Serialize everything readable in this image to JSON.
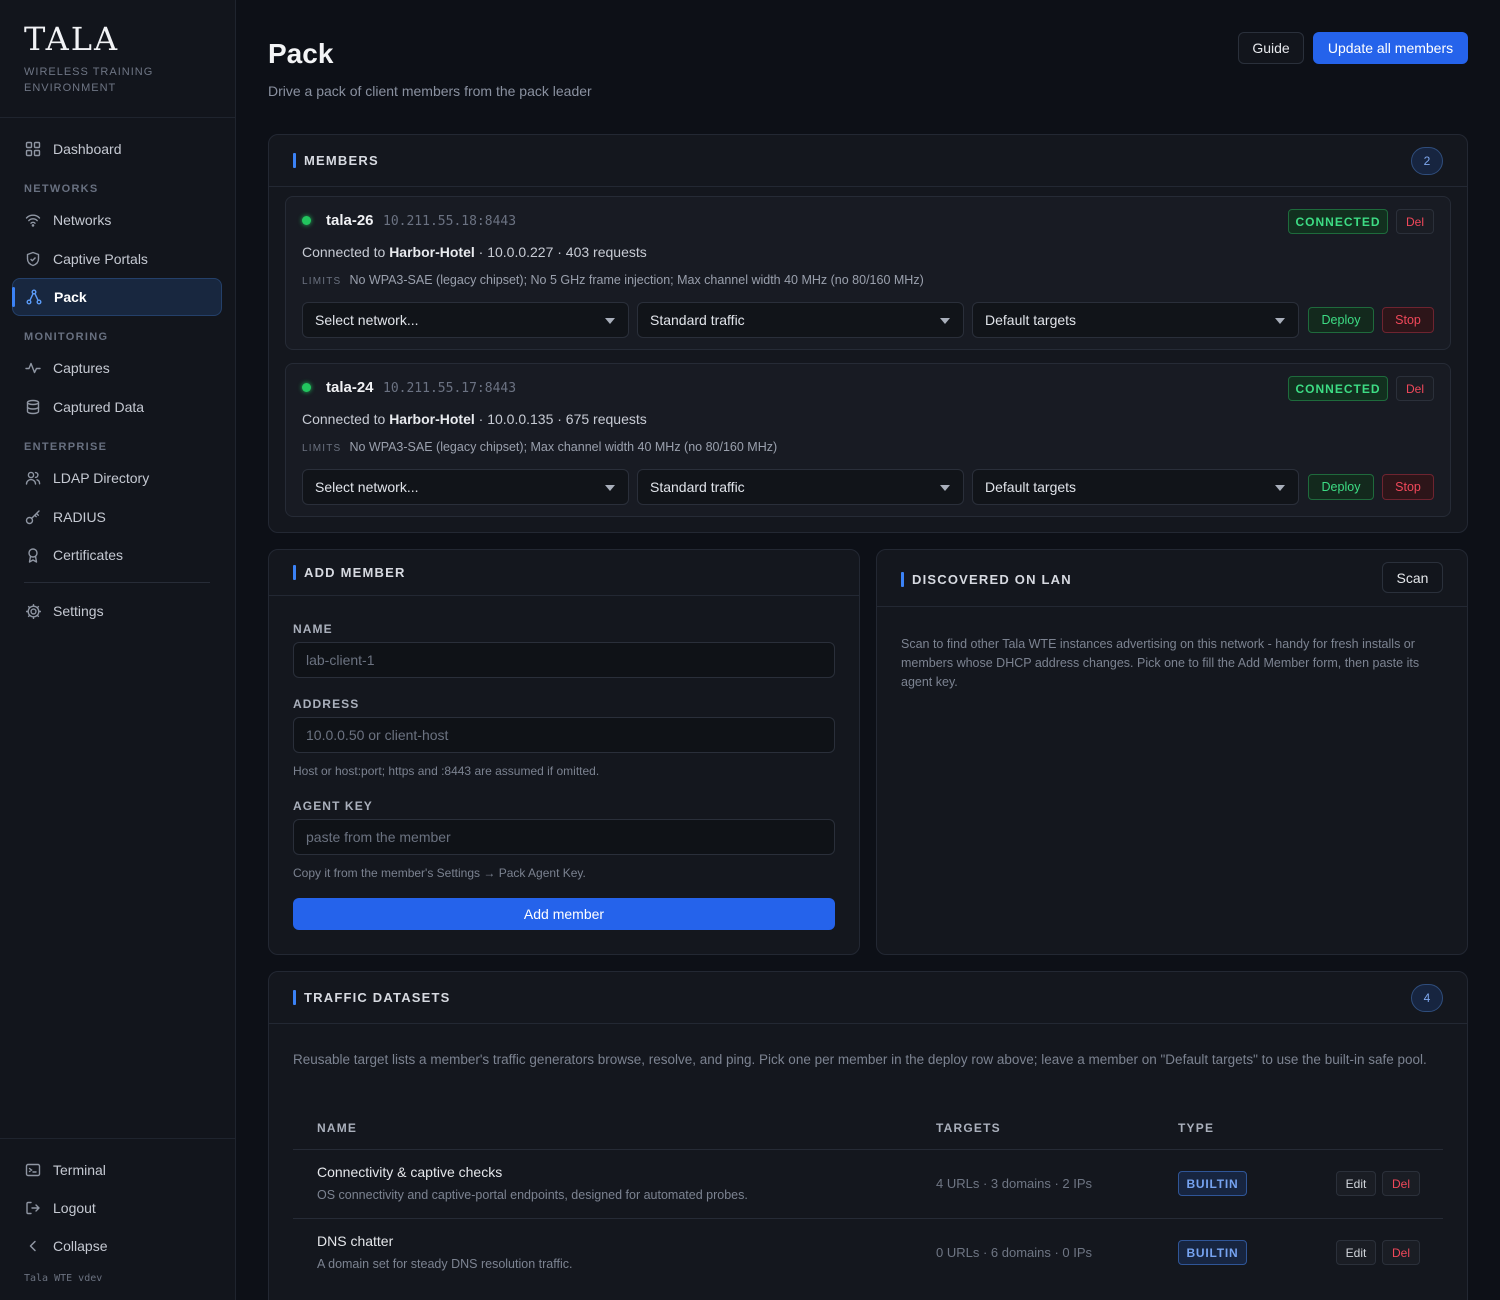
{
  "brand": {
    "logo": "TALA",
    "subtitle": "WIRELESS TRAINING ENVIRONMENT"
  },
  "nav": {
    "dashboard": "Dashboard",
    "section_networks": "NETWORKS",
    "networks": "Networks",
    "captive_portals": "Captive Portals",
    "pack": "Pack",
    "section_monitoring": "MONITORING",
    "captures": "Captures",
    "captured_data": "Captured Data",
    "section_enterprise": "ENTERPRISE",
    "ldap": "LDAP Directory",
    "radius": "RADIUS",
    "certificates": "Certificates",
    "settings": "Settings",
    "terminal": "Terminal",
    "logout": "Logout",
    "collapse": "Collapse",
    "version": "Tala WTE vdev"
  },
  "header": {
    "title": "Pack",
    "subtitle": "Drive a pack of client members from the pack leader",
    "guide": "Guide",
    "update_all": "Update all members"
  },
  "members": {
    "title": "MEMBERS",
    "count": "2",
    "items": [
      {
        "name": "tala-26",
        "address": "10.211.55.18:8443",
        "connected_prefix": "Connected to",
        "network": "Harbor-Hotel",
        "detail": "· 10.0.0.227 · 403 requests",
        "limits_label": "LIMITS",
        "limits": "No WPA3-SAE (legacy chipset); No 5 GHz frame injection; Max channel width 40 MHz (no 80/160 MHz)",
        "status": "CONNECTED",
        "del": "Del",
        "network_select": "Select network...",
        "traffic_select": "Standard traffic",
        "targets_select": "Default targets",
        "deploy": "Deploy",
        "stop": "Stop"
      },
      {
        "name": "tala-24",
        "address": "10.211.55.17:8443",
        "connected_prefix": "Connected to",
        "network": "Harbor-Hotel",
        "detail": "· 10.0.0.135 · 675 requests",
        "limits_label": "LIMITS",
        "limits": "No WPA3-SAE (legacy chipset); Max channel width 40 MHz (no 80/160 MHz)",
        "status": "CONNECTED",
        "del": "Del",
        "network_select": "Select network...",
        "traffic_select": "Standard traffic",
        "targets_select": "Default targets",
        "deploy": "Deploy",
        "stop": "Stop"
      }
    ]
  },
  "add_member": {
    "title": "ADD MEMBER",
    "name_label": "NAME",
    "name_placeholder": "lab-client-1",
    "address_label": "ADDRESS",
    "address_placeholder": "10.0.0.50 or client-host",
    "address_hint": "Host or host:port; https and :8443 are assumed if omitted.",
    "key_label": "AGENT KEY",
    "key_placeholder": "paste from the member",
    "key_hint": "Copy it from the member's Settings → Pack Agent Key.",
    "submit": "Add member"
  },
  "discovered": {
    "title": "DISCOVERED ON LAN",
    "scan": "Scan",
    "description": "Scan to find other Tala WTE instances advertising on this network - handy for fresh installs or members whose DHCP address changes. Pick one to fill the Add Member form, then paste its agent key."
  },
  "datasets": {
    "title": "TRAFFIC DATASETS",
    "count": "4",
    "description": "Reusable target lists a member's traffic generators browse, resolve, and ping. Pick one per member in the deploy row above; leave a member on \"Default targets\" to use the built-in safe pool.",
    "columns": {
      "name": "NAME",
      "targets": "TARGETS",
      "type": "TYPE"
    },
    "rows": [
      {
        "name": "Connectivity & captive checks",
        "desc": "OS connectivity and captive-portal endpoints, designed for automated probes.",
        "targets": "4 URLs · 3 domains · 2 IPs",
        "type": "BUILTIN",
        "edit": "Edit",
        "del": "Del"
      },
      {
        "name": "DNS chatter",
        "desc": "A domain set for steady DNS resolution traffic.",
        "targets": "0 URLs · 6 domains · 0 IPs",
        "type": "BUILTIN",
        "edit": "Edit",
        "del": "Del"
      }
    ]
  },
  "colors": {
    "accent": "#2563eb",
    "success": "#3ddc84",
    "danger": "#f0485a",
    "background": "#0d1017"
  }
}
